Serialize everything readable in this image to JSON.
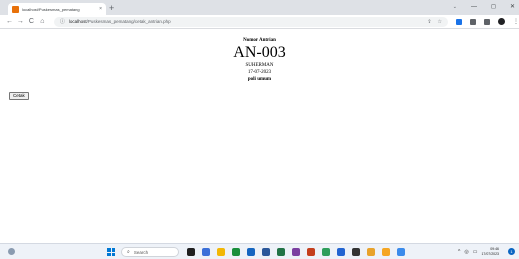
{
  "browser": {
    "tab_title": "localhost/Puskesmas_pematang",
    "tab_close": "×",
    "new_tab": "+",
    "window_controls": [
      "⌄",
      "—",
      "◻",
      "✕"
    ],
    "nav": {
      "back": "←",
      "forward": "→",
      "reload": "C",
      "home": "⌂"
    },
    "address": {
      "host": "localhost",
      "path": "/Puskesmas_pematang/cetak_antrian.php"
    },
    "omni_icons": [
      "⇪",
      "☆"
    ],
    "menu": "⋮"
  },
  "ticket": {
    "heading": "Nomor Antrian",
    "number": "AN-003",
    "name": "SUHERMAN",
    "date": "17-07-2023",
    "poli": "poli umum"
  },
  "print_button": "Cetak",
  "taskbar": {
    "search_placeholder": "Search",
    "search_glyph": "⌕",
    "app_colors": [
      "#1f1f1f",
      "#3b6fd8",
      "#f2b705",
      "#1a8f3c",
      "#1565c0",
      "#2b579a",
      "#217346",
      "#7b3fa0",
      "#c43e1c",
      "#2e9e5b",
      "#2264d1",
      "#333333",
      "#e8a22b",
      "#f5a623",
      "#3b8beb"
    ],
    "tray_icons": [
      "^",
      "◎",
      "▭",
      "🔊"
    ],
    "time": "09:46",
    "date": "17/07/2023",
    "notification_count": "1"
  },
  "colors": {
    "tab_favicon": "#e8710a",
    "start": "#0078d4",
    "notif": "#0a66c2"
  }
}
